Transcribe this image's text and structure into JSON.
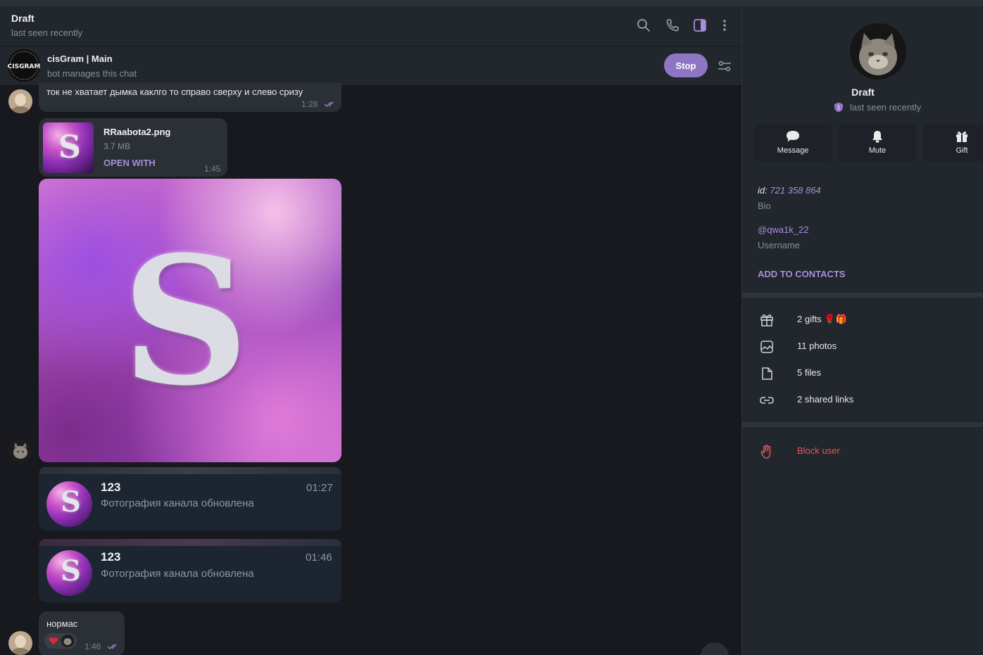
{
  "chat": {
    "title": "Draft",
    "status": "last seen recently"
  },
  "bot_bar": {
    "name": "cisGram | Main",
    "subtitle": "bot manages this chat",
    "avatar_text": "CISGRAM",
    "stop_label": "Stop"
  },
  "messages": {
    "m1": {
      "text": "ток не хватает дымка каклго то справо сверху и слево сризу",
      "time": "1:28"
    },
    "file": {
      "name": "RRaabota2.png",
      "size": "3.7 MB",
      "action": "OPEN WITH",
      "time": "1:45"
    },
    "svc1": {
      "title": "123",
      "subtitle": "Фотография канала обновлена",
      "time": "01:27"
    },
    "svc2": {
      "title": "123",
      "subtitle": "Фотография канала обновлена",
      "time": "01:46"
    },
    "m2": {
      "text": "нормас",
      "time": "1:46"
    }
  },
  "profile": {
    "name": "Draft",
    "status": "last seen recently",
    "badge": "1",
    "actions": {
      "message": "Message",
      "mute": "Mute",
      "gift": "Gift"
    },
    "id_prefix": "id:",
    "id_value": "721 358 864",
    "bio_label": "Bio",
    "username_value": "@qwa1k_22",
    "username_label": "Username",
    "add_contacts": "ADD TO CONTACTS",
    "gifts": "2 gifts",
    "gift_emojis": "🌹🎁",
    "photos": "11 photos",
    "files": "5 files",
    "links": "2 shared links",
    "block": "Block user"
  },
  "colors": {
    "accent": "#8f76c4",
    "link": "#a78fd8",
    "danger": "#e05a5a",
    "panel": "#22262d",
    "chat_bg": "#17191e"
  }
}
